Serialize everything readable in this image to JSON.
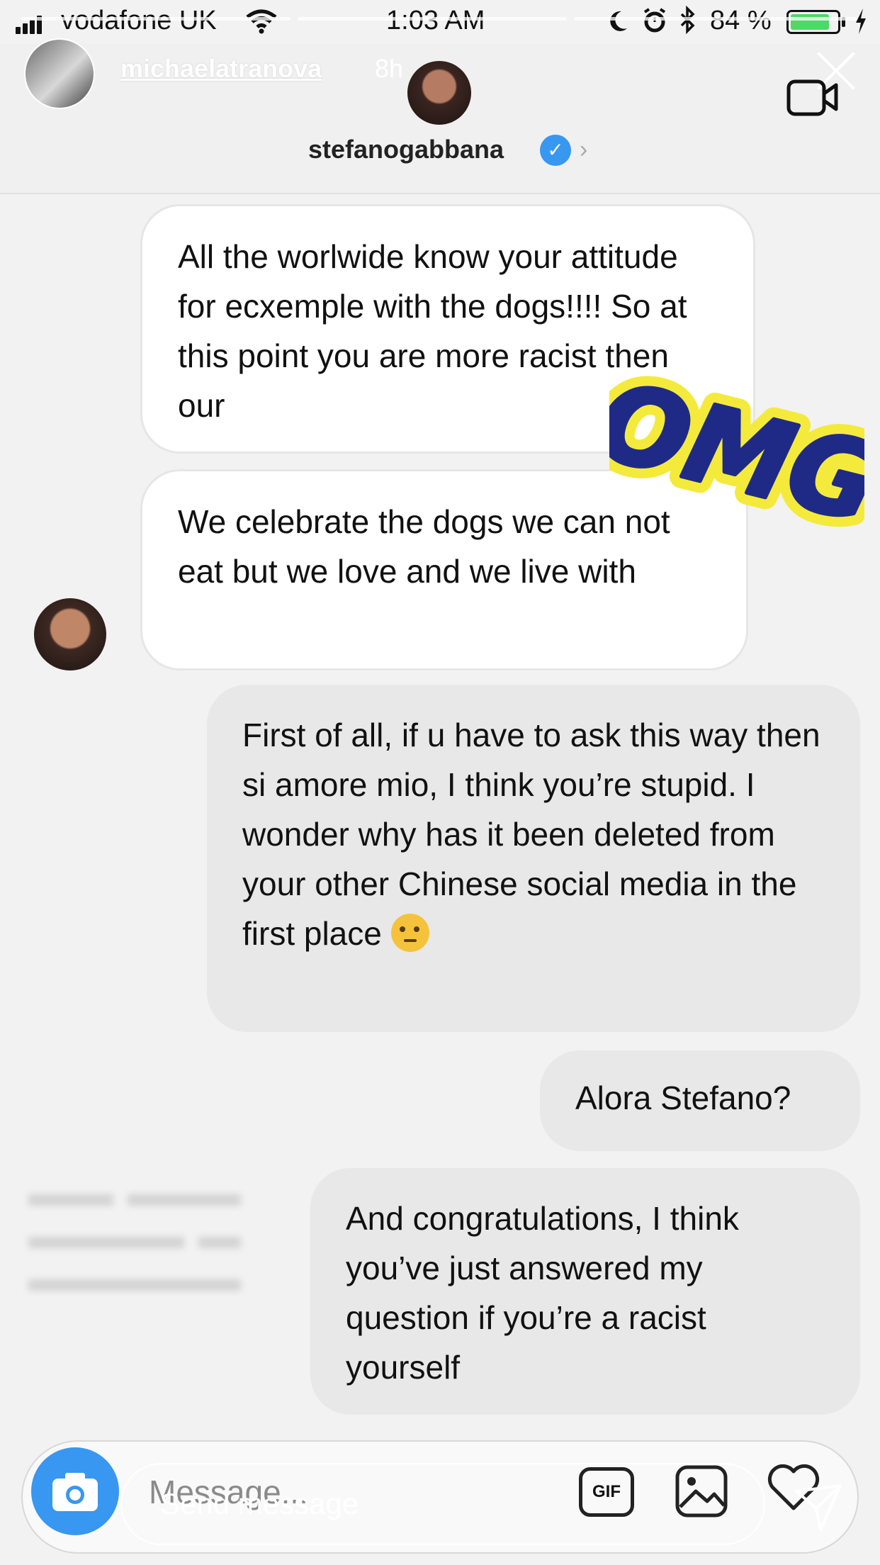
{
  "status_bar": {
    "carrier": "vodafone UK",
    "time": "1:03 AM",
    "battery_percent": "84 %",
    "battery_level": 0.84
  },
  "story": {
    "username": "michaelatranova",
    "time_ago": "8h"
  },
  "chat": {
    "name": "stefanogabbana"
  },
  "messages": [
    {
      "direction": "incoming",
      "text": "All the worlwide know your attitude for ecxemple with the dogs!!!! So at this point you are more racist then our"
    },
    {
      "direction": "incoming",
      "text": "We celebrate the dogs we can not eat but we love and we live with"
    },
    {
      "direction": "outgoing",
      "text": "First of all, if u have to ask this way then si amore mio, I think you’re stupid. I wonder why has it been deleted from your other Chinese social media in the first place",
      "emoji": "thinking-face"
    },
    {
      "direction": "outgoing",
      "text": "Alora Stefano?"
    },
    {
      "direction": "outgoing",
      "text": "And congratulations, I think you’ve just answered my question if you’re a racist yourself"
    }
  ],
  "sticker": {
    "text": "OMG",
    "fill": "#1f2a87",
    "outline": "#f4ea3c"
  },
  "composer": {
    "placeholder": "Message...",
    "send_message": "Send message",
    "gif_label": "GIF"
  },
  "colors": {
    "accent": "#3897f0",
    "battery": "#4cd964"
  }
}
